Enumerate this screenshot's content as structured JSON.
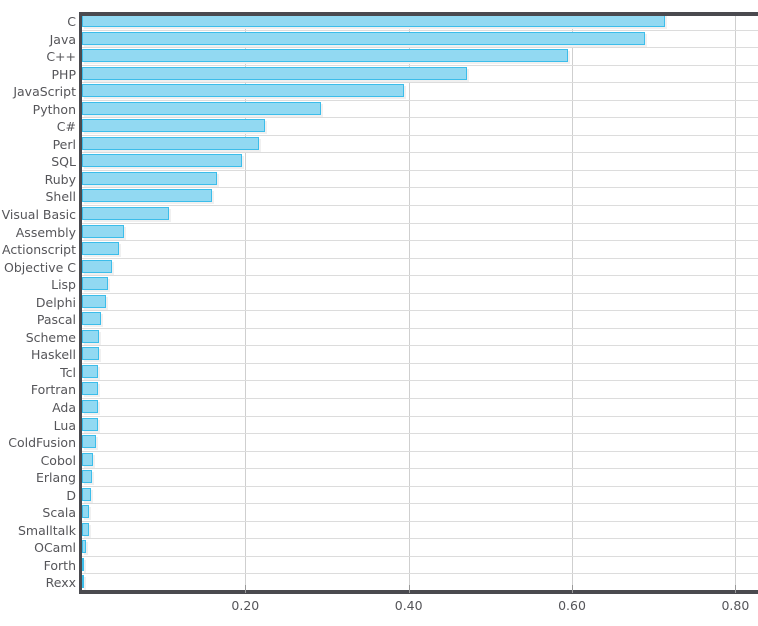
{
  "chart_data": {
    "type": "bar",
    "orientation": "horizontal",
    "title": "",
    "subtitle": "",
    "xlabel": "",
    "ylabel": "",
    "xlim": [
      0.0,
      0.83
    ],
    "grid": true,
    "legend": null,
    "xticks": [
      "0.20",
      "0.40",
      "0.60",
      "0.80"
    ],
    "xtick_values": [
      0.2,
      0.4,
      0.6,
      0.8
    ],
    "bar_color": "#92d9f2",
    "bar_border_color": "#3cbdea",
    "axis_color": "#4a4a4f",
    "gridline_color": "#dcdcdc",
    "label_color": "#555559",
    "categories": [
      "C",
      "Java",
      "C++",
      "PHP",
      "JavaScript",
      "Python",
      "C#",
      "Perl",
      "SQL",
      "Ruby",
      "Shell",
      "Visual Basic",
      "Assembly",
      "Actionscript",
      "Objective C",
      "Lisp",
      "Delphi",
      "Pascal",
      "Scheme",
      "Haskell",
      "Tcl",
      "Fortran",
      "Ada",
      "Lua",
      "ColdFusion",
      "Cobol",
      "Erlang",
      "D",
      "Scala",
      "Smalltalk",
      "OCaml",
      "Forth",
      "Rexx"
    ],
    "values": [
      0.714,
      0.689,
      0.595,
      0.471,
      0.394,
      0.293,
      0.224,
      0.217,
      0.196,
      0.165,
      0.159,
      0.107,
      0.052,
      0.045,
      0.037,
      0.032,
      0.029,
      0.023,
      0.021,
      0.021,
      0.02,
      0.02,
      0.02,
      0.019,
      0.017,
      0.014,
      0.012,
      0.011,
      0.009,
      0.008,
      0.005,
      0.003,
      0.001
    ]
  }
}
